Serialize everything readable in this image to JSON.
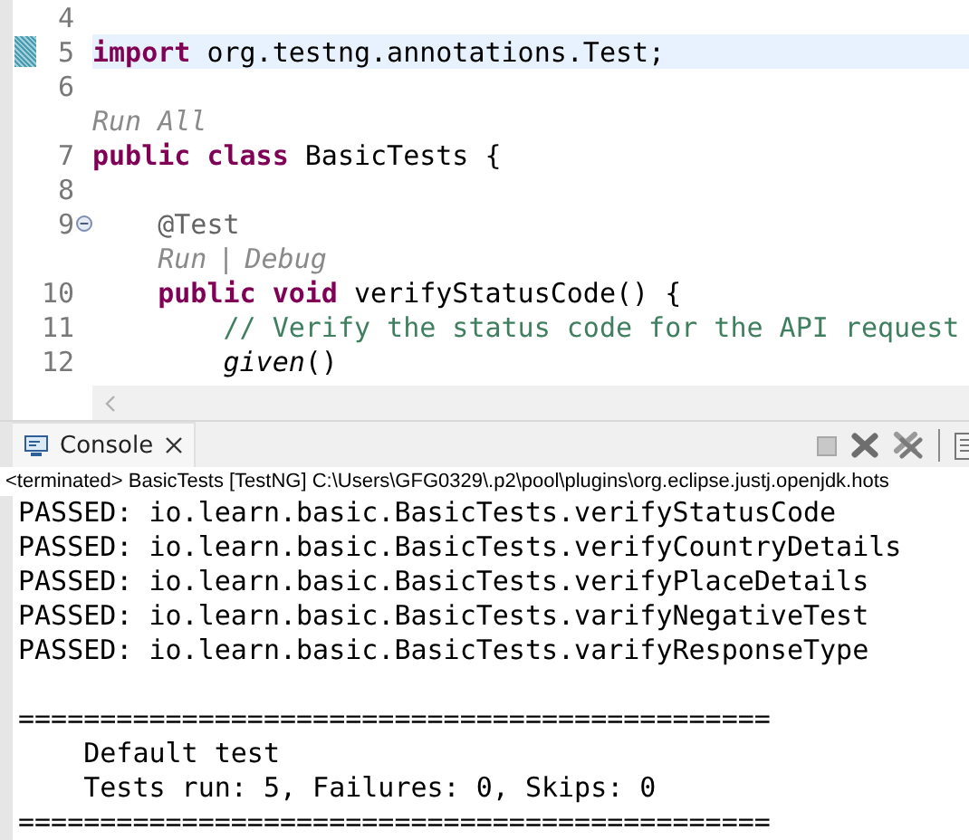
{
  "editor": {
    "lines": [
      {
        "kind": "code",
        "number": "4"
      },
      {
        "kind": "code",
        "number": "5",
        "current": true,
        "segments": [
          {
            "text": "import",
            "kind": "keyword"
          },
          {
            "text": " org.testng.annotations.Test;",
            "kind": "plain"
          }
        ]
      },
      {
        "kind": "code",
        "number": "6"
      },
      {
        "kind": "mining",
        "segments": [
          {
            "text": "Run All",
            "kind": "link"
          }
        ]
      },
      {
        "kind": "code",
        "number": "7",
        "segments": [
          {
            "text": "public class",
            "kind": "keyword"
          },
          {
            "text": " BasicTests {",
            "kind": "plain"
          }
        ]
      },
      {
        "kind": "code",
        "number": "8"
      },
      {
        "kind": "code",
        "number": "9",
        "foldable": true,
        "segments": [
          {
            "text": "    @Test",
            "kind": "annotation"
          }
        ]
      },
      {
        "kind": "mining",
        "segments": [
          {
            "text": "    Run",
            "kind": "link"
          },
          {
            "text": "|",
            "kind": "separator"
          },
          {
            "text": "Debug",
            "kind": "link"
          }
        ]
      },
      {
        "kind": "code",
        "number": "10",
        "segments": [
          {
            "text": "    public void",
            "kind": "keyword"
          },
          {
            "text": " verifyStatusCode() {",
            "kind": "plain"
          }
        ]
      },
      {
        "kind": "code",
        "number": "11",
        "segments": [
          {
            "text": "        // Verify the status code for the API request",
            "kind": "comment"
          }
        ]
      },
      {
        "kind": "code",
        "number": "12",
        "segments": [
          {
            "text": "        given",
            "kind": "static"
          },
          {
            "text": "()",
            "kind": "plain"
          }
        ]
      }
    ]
  },
  "console": {
    "tab": {
      "label": "Console",
      "selected": true
    },
    "status": "<terminated> BasicTests [TestNG] C:\\Users\\GFG0329\\.p2\\pool\\plugins\\org.eclipse.justj.openjdk.hots",
    "output": [
      {
        "lines": [
          "PASSED: io.learn.basic.BasicTests.verifyStatusCode",
          "PASSED: io.learn.basic.BasicTests.verifyCountryDetails",
          "PASSED: io.learn.basic.BasicTests.verifyPlaceDetails",
          "PASSED: io.learn.basic.BasicTests.varifyNegativeTest",
          "PASSED: io.learn.basic.BasicTests.varifyResponseType"
        ]
      },
      {
        "lines": [
          "==============================================",
          "    Default test",
          "    Tests run: 5, Failures: 0, Skips: 0",
          "=============================================="
        ]
      }
    ]
  }
}
